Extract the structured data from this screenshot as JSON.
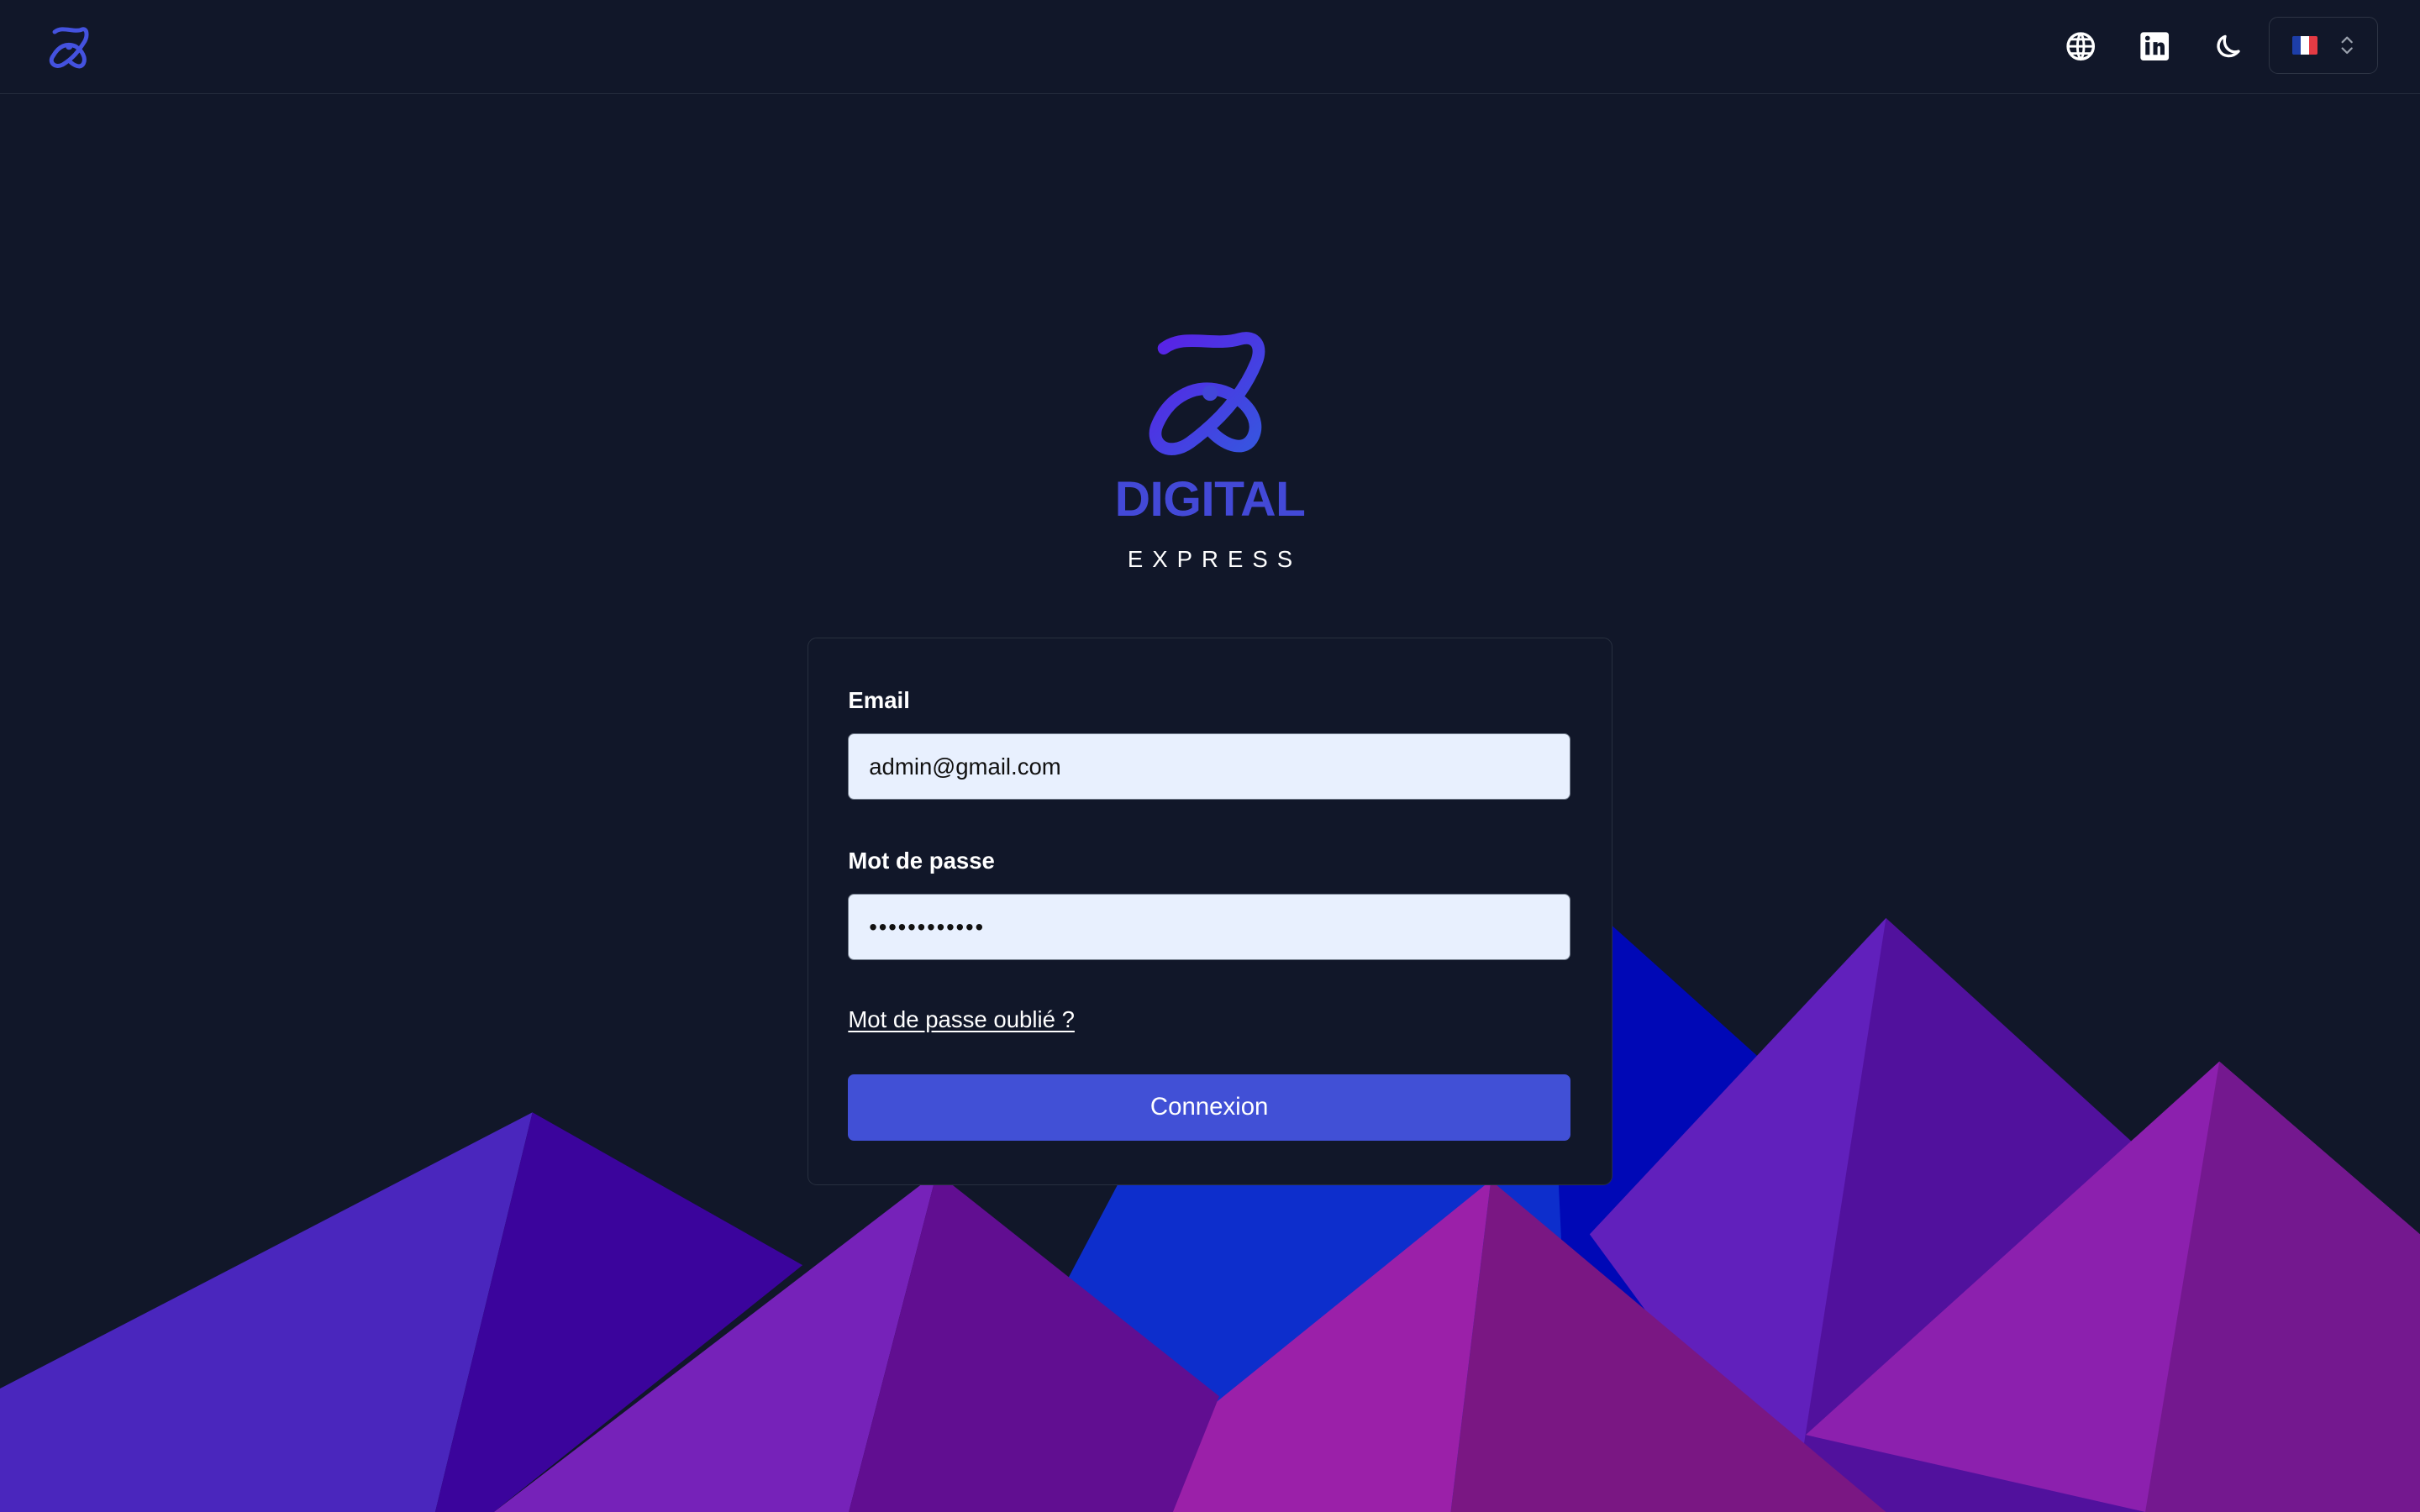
{
  "colors": {
    "background": "#111729",
    "accent": "#4150d6",
    "brand": "#4349d7",
    "input_background": "#e8f0fe",
    "text": "#ffffff"
  },
  "header": {
    "icons": [
      "brand-icon",
      "globe-icon",
      "linkedin-icon",
      "moon-icon",
      "france-flag-icon",
      "chevron-up-down-icon"
    ]
  },
  "brand": {
    "title": "DIGITAL",
    "subtitle": "EXPRESS"
  },
  "login": {
    "email_label": "Email",
    "email_value": "admin@gmail.com",
    "password_label": "Mot de passe",
    "password_value": "••••••••••••",
    "forgot_link": "Mot de passe oublié ?",
    "submit_label": "Connexion"
  }
}
